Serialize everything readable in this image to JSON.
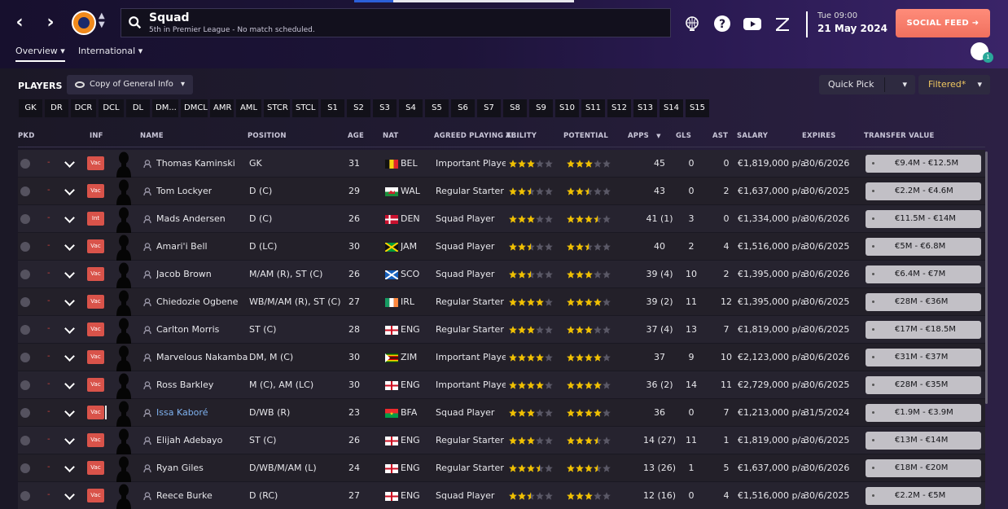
{
  "header": {
    "title": "Squad",
    "subtitle": "5th in Premier League - No match scheduled.",
    "date_line1": "Tue 09:00",
    "date_line2": "21 May 2024",
    "social_feed_label": "SOCIAL FEED",
    "avatar_badge": "1"
  },
  "subnav": {
    "overview": "Overview",
    "international": "International"
  },
  "toolbar": {
    "players_label": "PLAYERS",
    "view_label": "Copy of General Info",
    "quick_pick_label": "Quick Pick",
    "filtered_label": "Filtered*"
  },
  "positions": [
    "GK",
    "DR",
    "DCR",
    "DCL",
    "DL",
    "DM...",
    "DMCL",
    "AMR",
    "AML",
    "STCR",
    "STCL",
    "S1",
    "S2",
    "S3",
    "S4",
    "S5",
    "S6",
    "S7",
    "S8",
    "S9",
    "S10",
    "S11",
    "S12",
    "S13",
    "S14",
    "S15"
  ],
  "columns": {
    "pkd": "PKD",
    "inf": "INF",
    "name": "NAME",
    "position": "POSITION",
    "age": "AGE",
    "nat": "NAT",
    "playing_time": "AGREED PLAYING TI...",
    "ability": "ABILITY",
    "potential": "POTENTIAL",
    "apps": "APPS",
    "gls": "GLS",
    "ast": "AST",
    "salary": "SALARY",
    "expires": "EXPIRES",
    "transfer_value": "TRANSFER VALUE"
  },
  "players": [
    {
      "inf": "Vac",
      "name": "Thomas Kaminski",
      "position": "GK",
      "age": "31",
      "nat": "BEL",
      "flag": "BEL",
      "playing_time": "Important Player",
      "ability": 3,
      "potential": 3,
      "apps": "45",
      "gls": "0",
      "ast": "0",
      "salary": "€1,819,000 p/a",
      "expires": "30/6/2026",
      "value": "€9.4M - €12.5M"
    },
    {
      "inf": "Vac",
      "name": "Tom Lockyer",
      "position": "D (C)",
      "age": "29",
      "nat": "WAL",
      "flag": "WAL",
      "playing_time": "Regular Starter",
      "ability": 2.5,
      "potential": 2.5,
      "apps": "43",
      "gls": "0",
      "ast": "2",
      "salary": "€1,637,000 p/a",
      "expires": "30/6/2025",
      "value": "€2.2M - €4.6M"
    },
    {
      "inf": "Int",
      "name": "Mads Andersen",
      "position": "D (C)",
      "age": "26",
      "nat": "DEN",
      "flag": "DEN",
      "playing_time": "Squad Player",
      "ability": 3,
      "potential": 3.5,
      "apps": "41 (1)",
      "gls": "3",
      "ast": "0",
      "salary": "€1,334,000 p/a",
      "expires": "30/6/2026",
      "value": "€11.5M - €14M"
    },
    {
      "inf": "Vac",
      "name": "Amari'i Bell",
      "position": "D (LC)",
      "age": "30",
      "nat": "JAM",
      "flag": "JAM",
      "playing_time": "Squad Player",
      "ability": 2.5,
      "potential": 2.5,
      "apps": "40",
      "gls": "2",
      "ast": "4",
      "salary": "€1,516,000 p/a",
      "expires": "30/6/2025",
      "value": "€5M - €6.8M"
    },
    {
      "inf": "Vac",
      "name": "Jacob Brown",
      "position": "M/AM (R), ST (C)",
      "age": "26",
      "nat": "SCO",
      "flag": "SCO",
      "playing_time": "Squad Player",
      "ability": 2.5,
      "potential": 3,
      "apps": "39 (4)",
      "gls": "10",
      "ast": "2",
      "salary": "€1,395,000 p/a",
      "expires": "30/6/2026",
      "value": "€6.4M - €7M"
    },
    {
      "inf": "Vac",
      "name": "Chiedozie Ogbene",
      "position": "WB/M/AM (R), ST (C)",
      "age": "27",
      "nat": "IRL",
      "flag": "IRL",
      "playing_time": "Regular Starter",
      "ability": 4,
      "potential": 4,
      "apps": "39 (2)",
      "gls": "11",
      "ast": "12",
      "salary": "€1,395,000 p/a",
      "expires": "30/6/2025",
      "value": "€28M - €36M"
    },
    {
      "inf": "Vac",
      "name": "Carlton Morris",
      "position": "ST (C)",
      "age": "28",
      "nat": "ENG",
      "flag": "ENG",
      "playing_time": "Regular Starter",
      "ability": 3,
      "potential": 3,
      "apps": "37 (4)",
      "gls": "13",
      "ast": "7",
      "salary": "€1,819,000 p/a",
      "expires": "30/6/2025",
      "value": "€17M - €18.5M"
    },
    {
      "inf": "Vac",
      "name": "Marvelous Nakamba",
      "position": "DM, M (C)",
      "age": "30",
      "nat": "ZIM",
      "flag": "ZIM",
      "playing_time": "Important Player",
      "ability": 4,
      "potential": 4,
      "apps": "37",
      "gls": "9",
      "ast": "10",
      "salary": "€2,123,000 p/a",
      "expires": "30/6/2026",
      "value": "€31M - €37M"
    },
    {
      "inf": "Vac",
      "name": "Ross Barkley",
      "position": "M (C), AM (LC)",
      "age": "30",
      "nat": "ENG",
      "flag": "ENG",
      "playing_time": "Important Player",
      "ability": 4,
      "potential": 4,
      "apps": "36 (2)",
      "gls": "14",
      "ast": "11",
      "salary": "€2,729,000 p/a",
      "expires": "30/6/2025",
      "value": "€28M - €35M"
    },
    {
      "inf": "Vac",
      "name": "Issa Kaboré",
      "position": "D/WB (R)",
      "age": "23",
      "nat": "BFA",
      "flag": "BFA",
      "playing_time": "Squad Player",
      "ability": 3,
      "potential": 4,
      "apps": "36",
      "gls": "0",
      "ast": "7",
      "salary": "€1,213,000 p/a",
      "expires": "31/5/2024",
      "value": "€1.9M - €3.9M",
      "loan": true
    },
    {
      "inf": "Vac",
      "name": "Elijah Adebayo",
      "position": "ST (C)",
      "age": "26",
      "nat": "ENG",
      "flag": "ENG",
      "playing_time": "Regular Starter",
      "ability": 3,
      "potential": 3.5,
      "apps": "14 (27)",
      "gls": "11",
      "ast": "1",
      "salary": "€1,819,000 p/a",
      "expires": "30/6/2025",
      "value": "€13M - €14M"
    },
    {
      "inf": "Vac",
      "name": "Ryan Giles",
      "position": "D/WB/M/AM (L)",
      "age": "24",
      "nat": "ENG",
      "flag": "ENG",
      "playing_time": "Regular Starter",
      "ability": 3.5,
      "potential": 3.5,
      "apps": "13 (26)",
      "gls": "1",
      "ast": "5",
      "salary": "€1,637,000 p/a",
      "expires": "30/6/2026",
      "value": "€18M - €20M"
    },
    {
      "inf": "Vac",
      "name": "Reece Burke",
      "position": "D (RC)",
      "age": "27",
      "nat": "ENG",
      "flag": "ENG",
      "playing_time": "Squad Player",
      "ability": 2.5,
      "potential": 3,
      "apps": "12 (16)",
      "gls": "0",
      "ast": "4",
      "salary": "€1,516,000 p/a",
      "expires": "30/6/2025",
      "value": "€2.2M - €5M"
    }
  ],
  "colors": {
    "accent": "#f0705e",
    "star": "#f0c000",
    "star_empty": "#5a5866",
    "inf_badge": "#d9534a",
    "filtered": "#f0c860",
    "loan_name": "#7fb2f0"
  }
}
